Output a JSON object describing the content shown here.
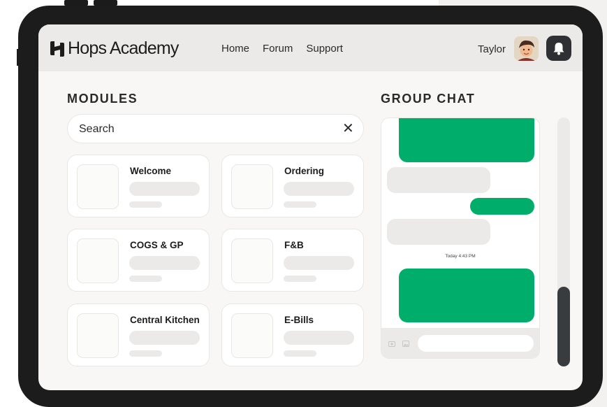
{
  "app": {
    "brand": "Hops Academy"
  },
  "nav": {
    "items": [
      "Home",
      "Forum",
      "Support"
    ]
  },
  "user": {
    "name": "Taylor"
  },
  "icons": {
    "logo": "hops-logo-icon",
    "bell": "bell-icon",
    "clear": "close-icon",
    "camera": "camera-icon",
    "image": "image-icon"
  },
  "colors": {
    "accent": "#00ad6a",
    "dark": "#2e3033",
    "surface": "#f8f7f5"
  },
  "modules": {
    "heading": "MODULES",
    "search": {
      "placeholder": "Search",
      "clear_glyph": "✕"
    },
    "cards": [
      {
        "title": "Welcome"
      },
      {
        "title": "Ordering"
      },
      {
        "title": "COGS & GP"
      },
      {
        "title": "F&B"
      },
      {
        "title": "Central Kitchen"
      },
      {
        "title": "E-Bills"
      }
    ]
  },
  "chat": {
    "heading": "GROUP CHAT",
    "timestamp": "Today 4:43 PM"
  }
}
